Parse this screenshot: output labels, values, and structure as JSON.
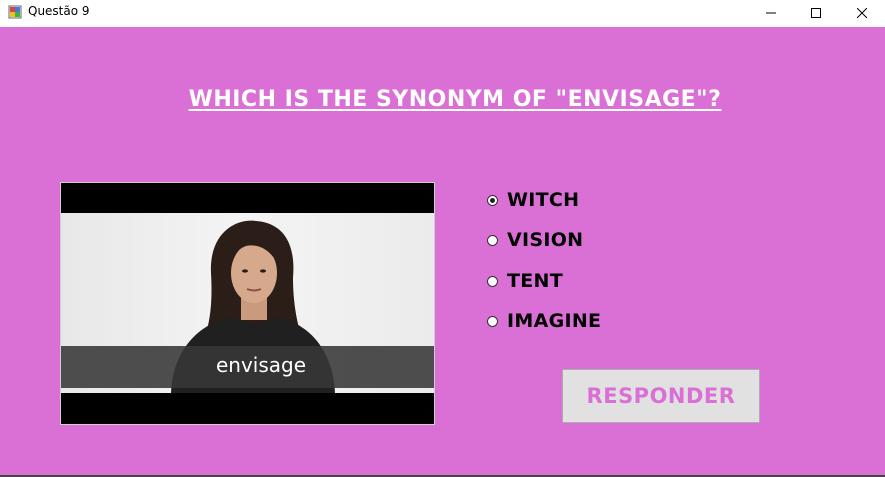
{
  "window": {
    "title": "Questão 9",
    "controls": [
      "minimize-icon",
      "maximize-icon",
      "close-icon"
    ]
  },
  "question": {
    "text": "Which is the synonym of \"envisage\"?"
  },
  "media": {
    "caption": "envisage"
  },
  "options": [
    {
      "label": "WITCH",
      "selected": true
    },
    {
      "label": "VISION",
      "selected": false
    },
    {
      "label": "TENT",
      "selected": false
    },
    {
      "label": "IMAGINE",
      "selected": false
    }
  ],
  "answer_button": {
    "label": "RESPONDER"
  },
  "colors": {
    "background": "#da70d6",
    "button_text": "#da70d6",
    "question_text": "#ffffff"
  }
}
